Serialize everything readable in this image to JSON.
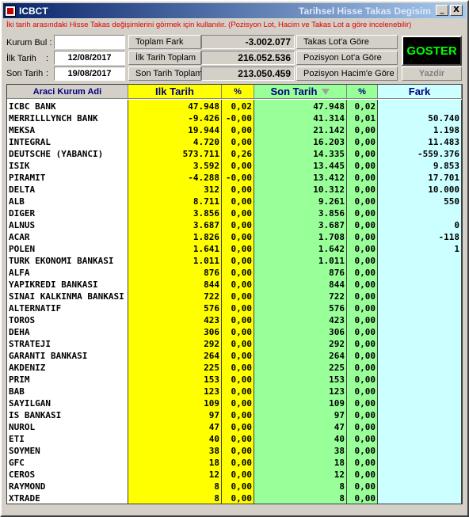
{
  "window": {
    "app_title": "ICBCT",
    "subtitle": "Tarihsel Hisse Takas Degisim",
    "minimize_label": "_",
    "close_label": "X"
  },
  "notice": "İki tarih arasındaki Hisse Takas değişimlerini görmek için kullanılır. (Pozisyon Lot, Hacim ve Takas Lot a göre incelenebilir)",
  "form": {
    "kurum_label": "Kurum Bul :",
    "kurum_value": "",
    "ilk_tarih_label": "İlk Tarih",
    "ilk_tarih_colon": ":",
    "ilk_tarih_value": "12/08/2017",
    "son_tarih_label": "Son Tarih",
    "son_tarih_colon": ":",
    "son_tarih_value": "19/08/2017"
  },
  "summary": {
    "toplam_fark_label": "Toplam Fark",
    "toplam_fark_value": "-3.002.077",
    "ilk_tarih_toplam_label": "İlk Tarih Toplam",
    "ilk_tarih_toplam_value": "216.052.536",
    "son_tarih_toplam_label": "Son Tarih Toplam",
    "son_tarih_toplam_value": "213.050.459"
  },
  "buttons": {
    "takas_lot": "Takas Lot'a Göre",
    "pozisyon_lot": "Pozisyon Lot'a Göre",
    "pozisyon_hacim": "Pozisyon Hacim'e Göre",
    "goster": "GOSTER",
    "yazdir": "Yazdir"
  },
  "colors": {
    "ilk_col": "#ffff00",
    "son_col": "#99ff99",
    "fark_col": "#ccffff",
    "goster_text": "#00ff00",
    "notice_text": "#e00000",
    "header_text": "#000080"
  },
  "grid": {
    "headers": {
      "name": "Araci Kurum Adi",
      "ilk": "Ilk Tarih",
      "p1": "%",
      "son": "Son Tarih",
      "p2": "%",
      "fark": "Fark"
    },
    "rows": [
      {
        "name": "ICBC BANK",
        "ilk": "47.948",
        "p1": "0,02",
        "son": "47.948",
        "p2": "0,02",
        "fark": ""
      },
      {
        "name": "MERRILLLYNCH BANK",
        "ilk": "-9.426",
        "p1": "-0,00",
        "son": "41.314",
        "p2": "0,01",
        "fark": "50.740"
      },
      {
        "name": "MEKSA",
        "ilk": "19.944",
        "p1": "0,00",
        "son": "21.142",
        "p2": "0,00",
        "fark": "1.198"
      },
      {
        "name": "INTEGRAL",
        "ilk": "4.720",
        "p1": "0,00",
        "son": "16.203",
        "p2": "0,00",
        "fark": "11.483"
      },
      {
        "name": "DEUTSCHE (YABANCI)",
        "ilk": "573.711",
        "p1": "0,26",
        "son": "14.335",
        "p2": "0,00",
        "fark": "-559.376"
      },
      {
        "name": "ISIK",
        "ilk": "3.592",
        "p1": "0,00",
        "son": "13.445",
        "p2": "0,00",
        "fark": "9.853"
      },
      {
        "name": "PIRAMIT",
        "ilk": "-4.288",
        "p1": "-0,00",
        "son": "13.412",
        "p2": "0,00",
        "fark": "17.701"
      },
      {
        "name": "DELTA",
        "ilk": "312",
        "p1": "0,00",
        "son": "10.312",
        "p2": "0,00",
        "fark": "10.000"
      },
      {
        "name": "ALB",
        "ilk": "8.711",
        "p1": "0,00",
        "son": "9.261",
        "p2": "0,00",
        "fark": "550"
      },
      {
        "name": "DIGER",
        "ilk": "3.856",
        "p1": "0,00",
        "son": "3.856",
        "p2": "0,00",
        "fark": ""
      },
      {
        "name": "ALNUS",
        "ilk": "3.687",
        "p1": "0,00",
        "son": "3.687",
        "p2": "0,00",
        "fark": "0"
      },
      {
        "name": "ACAR",
        "ilk": "1.826",
        "p1": "0,00",
        "son": "1.708",
        "p2": "0,00",
        "fark": "-118"
      },
      {
        "name": "POLEN",
        "ilk": "1.641",
        "p1": "0,00",
        "son": "1.642",
        "p2": "0,00",
        "fark": "1"
      },
      {
        "name": "TURK EKONOMI BANKASI",
        "ilk": "1.011",
        "p1": "0,00",
        "son": "1.011",
        "p2": "0,00",
        "fark": ""
      },
      {
        "name": "ALFA",
        "ilk": "876",
        "p1": "0,00",
        "son": "876",
        "p2": "0,00",
        "fark": ""
      },
      {
        "name": "YAPIKREDI BANKASI",
        "ilk": "844",
        "p1": "0,00",
        "son": "844",
        "p2": "0,00",
        "fark": ""
      },
      {
        "name": "SINAI KALKINMA BANKASI",
        "ilk": "722",
        "p1": "0,00",
        "son": "722",
        "p2": "0,00",
        "fark": ""
      },
      {
        "name": "ALTERNATIF",
        "ilk": "576",
        "p1": "0,00",
        "son": "576",
        "p2": "0,00",
        "fark": ""
      },
      {
        "name": "TOROS",
        "ilk": "423",
        "p1": "0,00",
        "son": "423",
        "p2": "0,00",
        "fark": ""
      },
      {
        "name": "DEHA",
        "ilk": "306",
        "p1": "0,00",
        "son": "306",
        "p2": "0,00",
        "fark": ""
      },
      {
        "name": "STRATEJI",
        "ilk": "292",
        "p1": "0,00",
        "son": "292",
        "p2": "0,00",
        "fark": ""
      },
      {
        "name": "GARANTI BANKASI",
        "ilk": "264",
        "p1": "0,00",
        "son": "264",
        "p2": "0,00",
        "fark": ""
      },
      {
        "name": "AKDENIZ",
        "ilk": "225",
        "p1": "0,00",
        "son": "225",
        "p2": "0,00",
        "fark": ""
      },
      {
        "name": "PRIM",
        "ilk": "153",
        "p1": "0,00",
        "son": "153",
        "p2": "0,00",
        "fark": ""
      },
      {
        "name": "BAB",
        "ilk": "123",
        "p1": "0,00",
        "son": "123",
        "p2": "0,00",
        "fark": ""
      },
      {
        "name": "SAYILGAN",
        "ilk": "109",
        "p1": "0,00",
        "son": "109",
        "p2": "0,00",
        "fark": ""
      },
      {
        "name": "IS BANKASI",
        "ilk": "97",
        "p1": "0,00",
        "son": "97",
        "p2": "0,00",
        "fark": ""
      },
      {
        "name": "NUROL",
        "ilk": "47",
        "p1": "0,00",
        "son": "47",
        "p2": "0,00",
        "fark": ""
      },
      {
        "name": "ETI",
        "ilk": "40",
        "p1": "0,00",
        "son": "40",
        "p2": "0,00",
        "fark": ""
      },
      {
        "name": "SOYMEN",
        "ilk": "38",
        "p1": "0,00",
        "son": "38",
        "p2": "0,00",
        "fark": ""
      },
      {
        "name": "GFC",
        "ilk": "18",
        "p1": "0,00",
        "son": "18",
        "p2": "0,00",
        "fark": ""
      },
      {
        "name": "CEROS",
        "ilk": "12",
        "p1": "0,00",
        "son": "12",
        "p2": "0,00",
        "fark": ""
      },
      {
        "name": "RAYMOND",
        "ilk": "8",
        "p1": "0,00",
        "son": "8",
        "p2": "0,00",
        "fark": ""
      },
      {
        "name": "XTRADE",
        "ilk": "8",
        "p1": "0,00",
        "son": "8",
        "p2": "0,00",
        "fark": ""
      }
    ]
  }
}
